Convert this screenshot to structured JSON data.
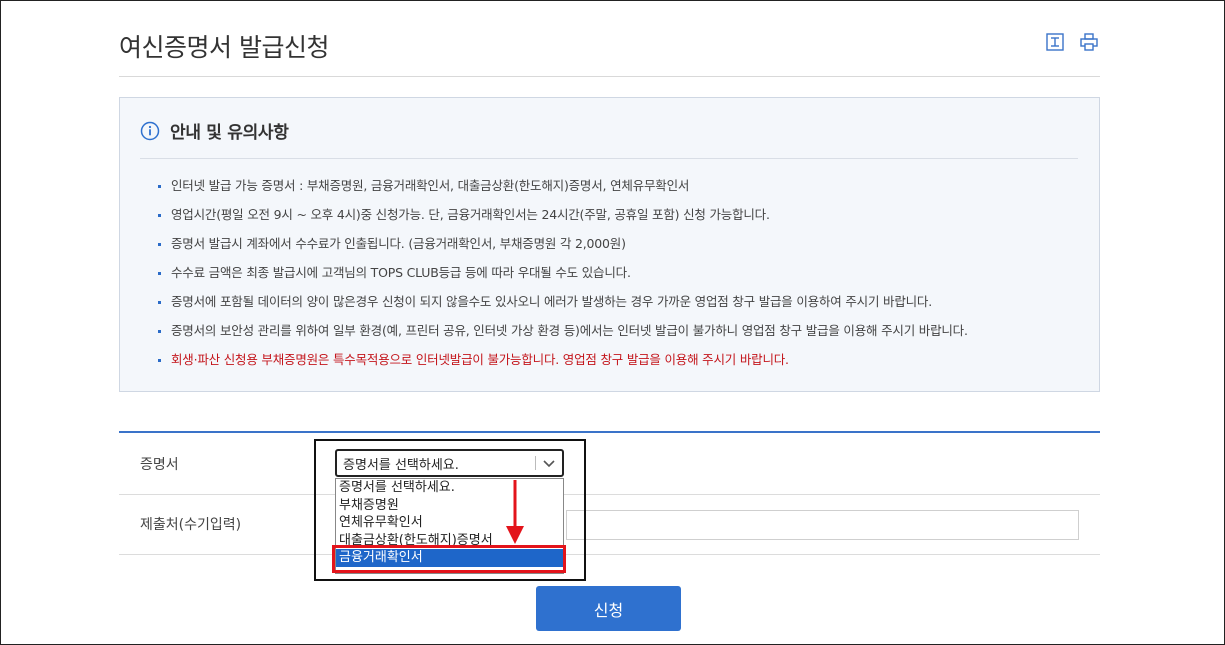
{
  "page": {
    "title": "여신증명서 발급신청"
  },
  "toolbar": {
    "download_icon": "download-icon",
    "print_icon": "print-icon"
  },
  "notice": {
    "title": "안내 및 유의사항",
    "items": [
      "인터넷 발급 가능 증명서 : 부채증명원, 금융거래확인서, 대출금상환(한도해지)증명서, 연체유무확인서",
      "영업시간(평일 오전 9시 ~ 오후 4시)중 신청가능. 단, 금융거래확인서는 24시간(주말, 공휴일 포함) 신청 가능합니다.",
      "증명서 발급시 계좌에서 수수료가 인출됩니다. (금융거래확인서, 부채증명원 각 2,000원)",
      "수수료 금액은 최종 발급시에 고객님의 TOPS CLUB등급 등에 따라 우대될 수도 있습니다.",
      "증명서에 포함될 데이터의 양이 많은경우 신청이 되지 않을수도 있사오니 에러가 발생하는 경우 가까운 영업점 창구 발급을 이용하여 주시기 바랍니다.",
      "증명서의 보안성 관리를 위하여 일부 환경(예, 프린터 공유, 인터넷 가상 환경 등)에서는 인터넷 발급이 불가하니 영업점 창구 발급을 이용해 주시기 바랍니다."
    ],
    "warning": "회생·파산 신청용 부채증명원은 특수목적용으로 인터넷발급이 불가능합니다. 영업점 창구 발급을 이용해 주시기 바랍니다."
  },
  "form": {
    "certificate_label": "증명서",
    "certificate_select_value": "증명서를 선택하세요.",
    "options": [
      "증명서를 선택하세요.",
      "부채증명원",
      "연체유무확인서",
      "대출금상환(한도해지)증명서",
      "금융거래확인서"
    ],
    "selected_option_index": 4,
    "submit_to_label": "제출처(수기입력)",
    "submit_to_value": "",
    "submit_button": "신청"
  },
  "colors": {
    "accent": "#2f71cf",
    "warning": "#c4161c",
    "highlight": "#e3141b",
    "selected_option": "#1e66c9"
  }
}
